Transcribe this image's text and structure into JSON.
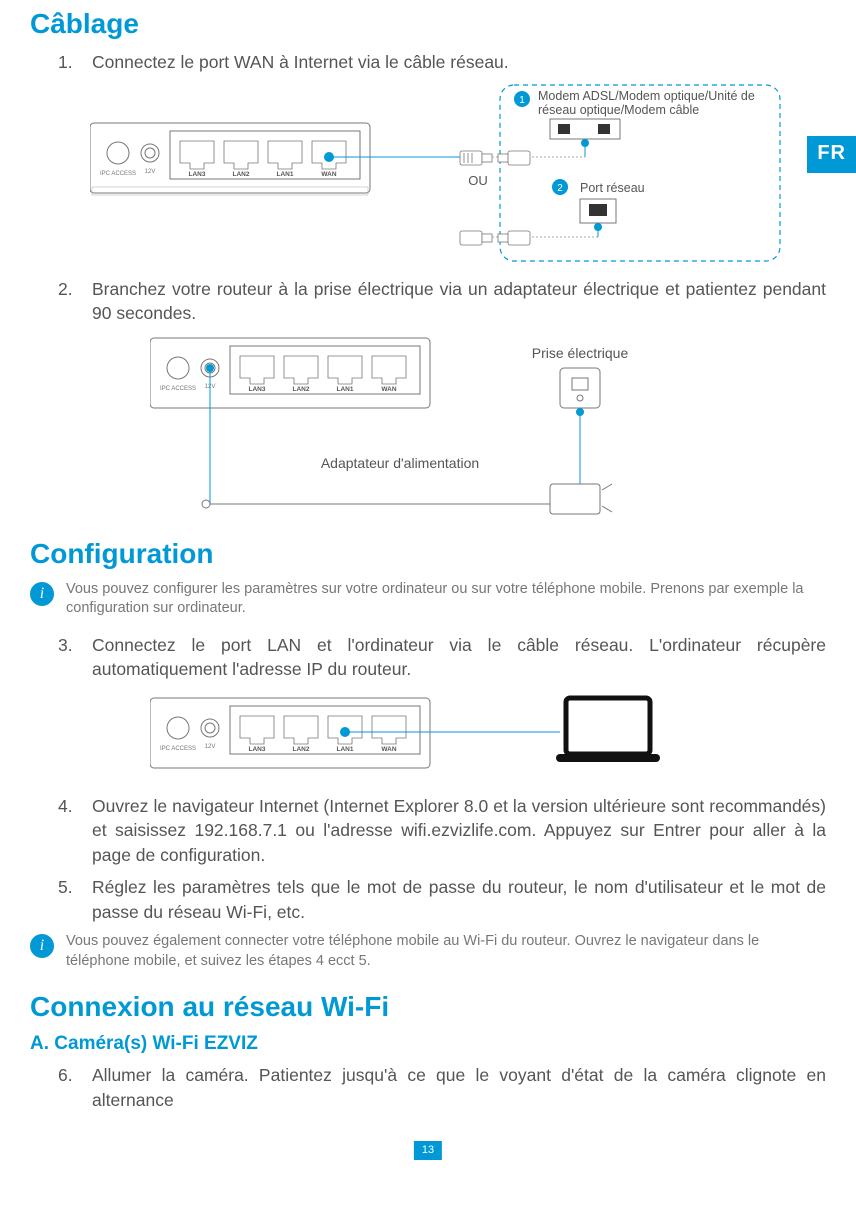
{
  "lang_tab": "FR",
  "page_number": "13",
  "section_cablage": {
    "title": "Câblage",
    "step1_num": "1.",
    "step1_text": "Connectez le port WAN à Internet via le câble réseau.",
    "step2_num": "2.",
    "step2_text": "Branchez votre routeur à la prise électrique via un adaptateur électrique et patientez pendant 90 secondes."
  },
  "diagram1": {
    "router": {
      "ipc_access": "IPC ACCESS",
      "power_12v": "12V",
      "lan3": "LAN3",
      "lan2": "LAN2",
      "lan1": "LAN1",
      "wan": "WAN"
    },
    "or_label": "OU",
    "badge1": "1",
    "badge2": "2",
    "modem_label": "Modem ADSL/Modem optique/Unité de réseau optique/Modem câble",
    "port_label": "Port réseau"
  },
  "diagram2": {
    "router": {
      "ipc_access": "IPC ACCESS",
      "power_12v": "12V",
      "lan3": "LAN3",
      "lan2": "LAN2",
      "lan1": "LAN1",
      "wan": "WAN"
    },
    "prise_label": "Prise électrique",
    "adapter_label": "Adaptateur d'alimentation"
  },
  "section_config": {
    "title": "Configuration",
    "info1_text": "Vous pouvez configurer les paramètres sur votre ordinateur ou sur votre téléphone mobile. Prenons par exemple la configuration sur ordinateur.",
    "step3_num": "3.",
    "step3_text": "Connectez le port LAN et l'ordinateur via le câble réseau. L'ordinateur récupère automatiquement l'adresse IP du routeur.",
    "step4_num": "4.",
    "step4_text": "Ouvrez le navigateur Internet (Internet Explorer 8.0 et la version ultérieure sont recommandés) et saisissez 192.168.7.1 ou l'adresse wifi.ezvizlife.com. Appuyez sur Entrer pour aller à la page de configuration.",
    "step5_num": "5.",
    "step5_text": "Réglez les paramètres tels que le mot de passe du routeur, le nom d'utilisateur et le mot de passe du réseau Wi-Fi, etc.",
    "info2_text": "Vous pouvez également connecter votre téléphone mobile au Wi-Fi du routeur. Ouvrez le navigateur dans le téléphone mobile, et suivez les étapes 4 ecct 5."
  },
  "diagram3": {
    "router": {
      "ipc_access": "IPC ACCESS",
      "power_12v": "12V",
      "lan3": "LAN3",
      "lan2": "LAN2",
      "lan1": "LAN1",
      "wan": "WAN"
    }
  },
  "section_wifi": {
    "title": "Connexion au réseau Wi-Fi",
    "subtitle": "A. Caméra(s) Wi-Fi EZVIZ",
    "step6_num": "6.",
    "step6_text": "Allumer la caméra. Patientez jusqu'à ce que le voyant d'état de la caméra clignote en alternance"
  },
  "info_icon_glyph": "i"
}
